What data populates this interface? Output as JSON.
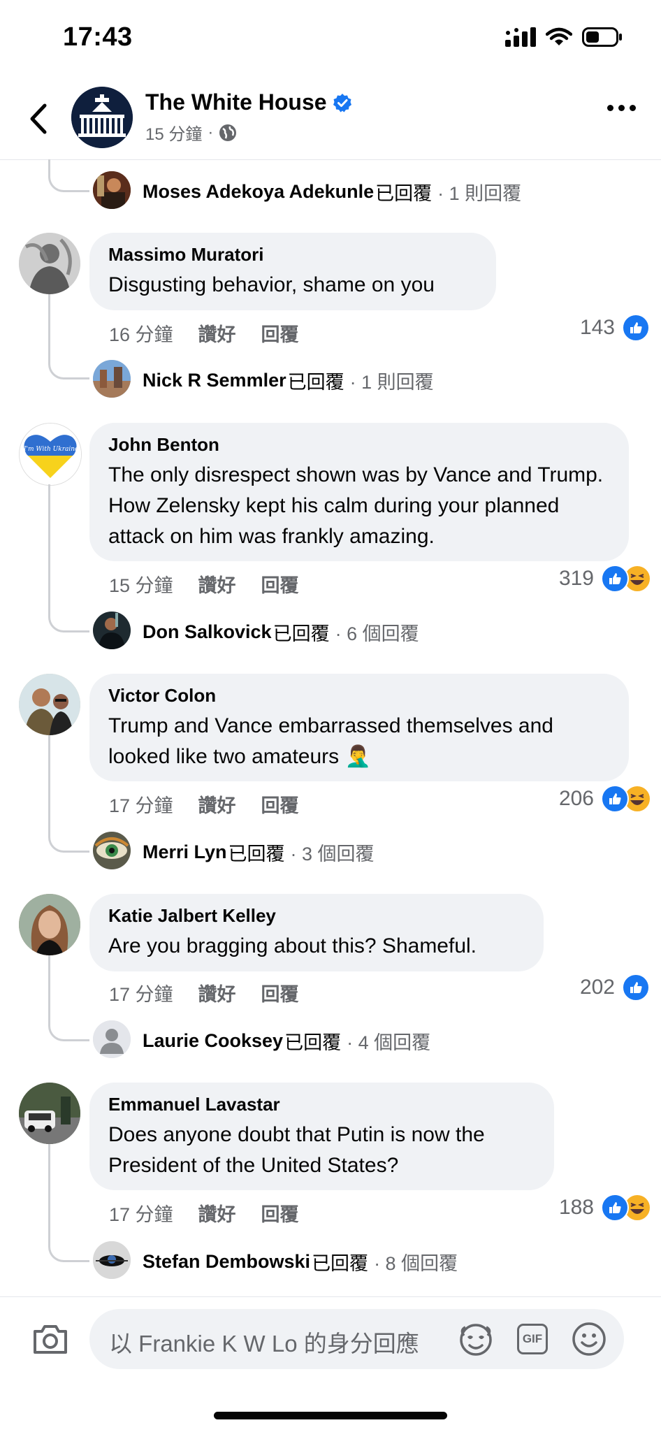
{
  "status_bar": {
    "time": "17:43"
  },
  "header": {
    "page_name": "The White House",
    "time": "15 分鐘",
    "dot": "·"
  },
  "top_reply": {
    "name": "Moses Adekoya Adekunle",
    "suffix": "已回覆",
    "count": "· 1 則回覆"
  },
  "comments": [
    {
      "author": "Massimo Muratori",
      "text": "Disgusting behavior, shame on you",
      "time": "16 分鐘",
      "like": "讚好",
      "reply": "回覆",
      "reactions": "143",
      "reply_name": "Nick R Semmler",
      "reply_suffix": "已回覆",
      "reply_count": "· 1 則回覆"
    },
    {
      "author": "John Benton",
      "text": "The only disrespect shown was by Vance and Trump. How Zelensky kept his calm during your planned attack on him was frankly amazing.",
      "time": "15 分鐘",
      "like": "讚好",
      "reply": "回覆",
      "reactions": "319",
      "reply_name": "Don Salkovick",
      "reply_suffix": "已回覆",
      "reply_count": "· 6 個回覆",
      "badge_text": "I'm With Ukraine"
    },
    {
      "author": "Victor Colon",
      "text": "Trump and Vance embarrassed themselves and looked like two amateurs",
      "emoji": "🤦‍♂️",
      "time": "17 分鐘",
      "like": "讚好",
      "reply": "回覆",
      "reactions": "206",
      "reply_name": "Merri Lyn",
      "reply_suffix": "已回覆",
      "reply_count": "· 3 個回覆"
    },
    {
      "author": "Katie Jalbert Kelley",
      "text": "Are you bragging about this? Shameful.",
      "time": "17 分鐘",
      "like": "讚好",
      "reply": "回覆",
      "reactions": "202",
      "reply_name": "Laurie Cooksey",
      "reply_suffix": "已回覆",
      "reply_count": "· 4 個回覆"
    },
    {
      "author": "Emmanuel Lavastar",
      "text": "Does anyone doubt that Putin is now the President of the United States?",
      "time": "17 分鐘",
      "like": "讚好",
      "reply": "回覆",
      "reactions": "188",
      "reply_name": "Stefan Dembowski",
      "reply_suffix": "已回覆",
      "reply_count": "· 8 個回覆"
    }
  ],
  "composer": {
    "placeholder": "以 Frankie K W Lo 的身分回應",
    "gif_label": "GIF"
  },
  "colors": {
    "accent": "#1877f2",
    "bubble": "#f0f2f5",
    "secondary_text": "#65676b"
  }
}
